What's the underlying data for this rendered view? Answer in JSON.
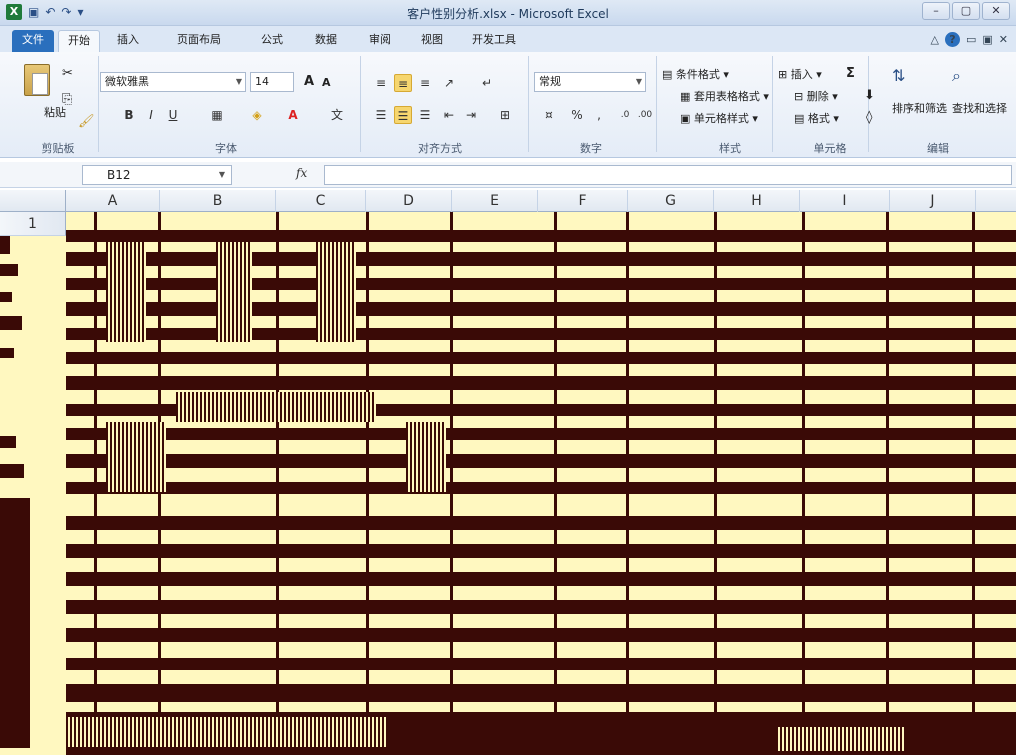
{
  "window": {
    "title": "客户性别分析.xlsx - Microsoft Excel",
    "app_icon": "X",
    "qat_icons": [
      "save-icon",
      "undo-icon",
      "redo-icon",
      "customize-icon"
    ]
  },
  "tabs": [
    {
      "label": "文件"
    },
    {
      "label": "开始"
    },
    {
      "label": "插入"
    },
    {
      "label": "页面布局"
    },
    {
      "label": "公式"
    },
    {
      "label": "数据"
    },
    {
      "label": "审阅"
    },
    {
      "label": "视图"
    },
    {
      "label": "开发工具"
    }
  ],
  "ribbon": {
    "clipboard": {
      "paste_label": "粘贴",
      "group_label": "剪贴板"
    },
    "font": {
      "font_name": "微软雅黑",
      "font_size": "14",
      "group_label": "字体"
    },
    "alignment": {
      "group_label": "对齐方式"
    },
    "number": {
      "format": "常规",
      "percent": "%",
      "comma": ",",
      "group_label": "数字"
    },
    "styles": {
      "conditional": "条件格式",
      "table_format": "套用表格格式",
      "cell_styles": "单元格样式",
      "group_label": "样式"
    },
    "cells": {
      "insert": "插入",
      "delete": "删除",
      "format": "格式",
      "group_label": "单元格"
    },
    "editing": {
      "sum": "Σ",
      "sort_filter": "排序和筛选",
      "find_select": "查找和选择",
      "group_label": "编辑"
    }
  },
  "formula_bar": {
    "name_box": "B12",
    "fx": "fx",
    "formula": ""
  },
  "grid": {
    "columns": [
      "A",
      "B",
      "C",
      "D",
      "E",
      "F",
      "G",
      "H",
      "I",
      "J"
    ],
    "first_row": "1"
  },
  "colors": {
    "sheet_background": "#fff8c0",
    "sheet_noise": "#3a0a06",
    "file_tab": "#2a6fbd"
  }
}
